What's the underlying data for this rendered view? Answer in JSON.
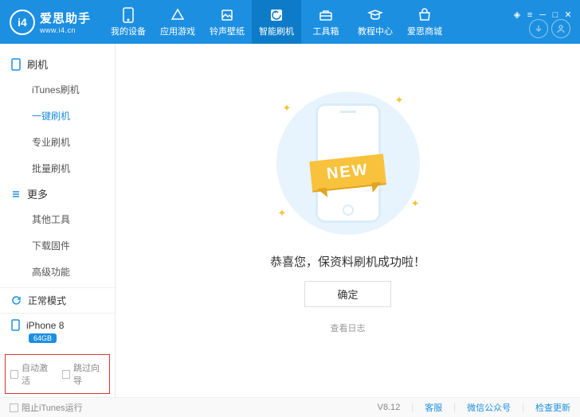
{
  "brand": {
    "badge": "i4",
    "title": "爱思助手",
    "url": "www.i4.cn"
  },
  "nav": {
    "items": [
      {
        "label": "我的设备"
      },
      {
        "label": "应用游戏"
      },
      {
        "label": "铃声壁纸"
      },
      {
        "label": "智能刷机"
      },
      {
        "label": "工具箱"
      },
      {
        "label": "教程中心"
      },
      {
        "label": "爱思商城"
      }
    ]
  },
  "sidebar": {
    "sections": [
      {
        "title": "刷机",
        "items": [
          "iTunes刷机",
          "一键刷机",
          "专业刷机",
          "批量刷机"
        ]
      },
      {
        "title": "更多",
        "items": [
          "其他工具",
          "下载固件",
          "高级功能"
        ]
      }
    ],
    "status": "正常模式",
    "device": {
      "name": "iPhone 8",
      "storage": "64GB"
    },
    "checks": [
      "自动激活",
      "跳过向导"
    ]
  },
  "content": {
    "ribbon": "NEW",
    "message": "恭喜您，保资料刷机成功啦！",
    "confirm": "确定",
    "log": "查看日志"
  },
  "footer": {
    "block_itunes": "阻止iTunes运行",
    "version": "V8.12",
    "support": "客服",
    "wechat": "微信公众号",
    "update": "检查更新"
  }
}
